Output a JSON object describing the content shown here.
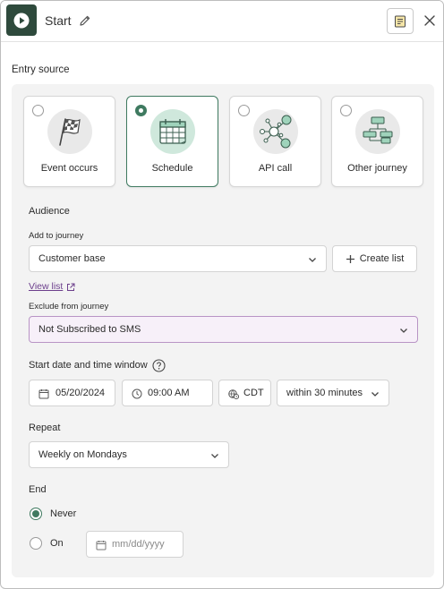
{
  "header": {
    "title": "Start",
    "play_icon": "play-icon",
    "edit_icon": "pencil-icon",
    "notes_icon": "notes-icon",
    "close_icon": "close-icon"
  },
  "entry_source": {
    "heading": "Entry source",
    "options": [
      {
        "label": "Event occurs",
        "icon": "checkered-flag-icon",
        "selected": false
      },
      {
        "label": "Schedule",
        "icon": "calendar-icon",
        "selected": true
      },
      {
        "label": "API call",
        "icon": "api-network-icon",
        "selected": false
      },
      {
        "label": "Other journey",
        "icon": "flowchart-icon",
        "selected": false
      }
    ]
  },
  "audience": {
    "heading": "Audience",
    "add_label": "Add to journey",
    "add_value": "Customer base",
    "create_list_label": "Create list",
    "view_list_label": "View list",
    "exclude_label": "Exclude from journey",
    "exclude_value": "Not Subscribed to SMS"
  },
  "schedule": {
    "heading": "Start date and time window",
    "date": "05/20/2024",
    "time": "09:00 AM",
    "timezone": "CDT",
    "window": "within 30 minutes"
  },
  "repeat": {
    "heading": "Repeat",
    "value": "Weekly on Mondays"
  },
  "end": {
    "heading": "End",
    "never_label": "Never",
    "on_label": "On",
    "date_placeholder": "mm/dd/yyyy",
    "selected": "never"
  },
  "colors": {
    "accent_green": "#3f7a60",
    "header_button": "#2e4a3c",
    "exclude_background": "#f7f0f9",
    "link_purple": "#6c3f8c"
  }
}
